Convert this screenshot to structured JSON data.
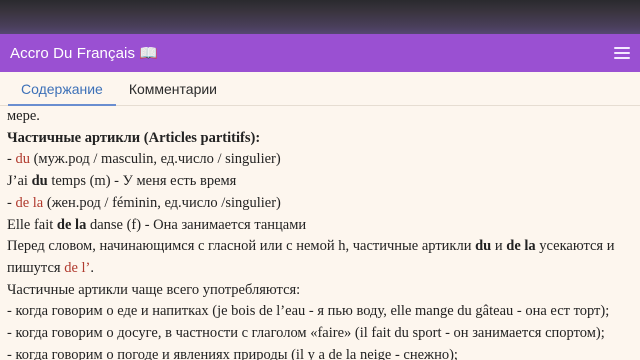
{
  "app": {
    "title": "Accro Du Français 📖"
  },
  "tabs": [
    {
      "label": "Содержание"
    },
    {
      "label": "Комментарии"
    }
  ],
  "content": {
    "line0": "мере.",
    "heading": "Частичные артикли (Articles partitifs):",
    "l1": {
      "dash": "- ",
      "article": "du",
      "rest": " (муж.род / masculin, ед.число / singulier)"
    },
    "l2": {
      "pre": "J’ai ",
      "article": "du",
      "rest": " temps (m) - У меня есть время"
    },
    "l3": {
      "dash": "- ",
      "article": "de la",
      "rest": " (жен.род / féminin, ед.число /singulier)"
    },
    "l4": {
      "pre": "Elle fait ",
      "article": "de la",
      "rest": " danse (f) - Она занимается танцами"
    },
    "l5": {
      "pre": "Перед словом, начинающимся с гласной или с немой h, частичные артикли ",
      "a1": "du",
      "mid": " и ",
      "a2": "de la",
      "post": " усекаются и пишутся ",
      "red": "de l’",
      "end": "."
    },
    "l6": "Частичные артикли чаще всего употребляются:",
    "l7": "- когда говорим о еде и напитках (je bois de l’eau - я пью воду, elle mange du gâteau - она ест торт);",
    "l8": "- когда говорим о досуге, в частности с глаголом «faire» (il fait du sport - он занимается спортом);",
    "l9": "- когда говорим о погоде и явлениях природы (il y a de la neige - снежно);"
  }
}
